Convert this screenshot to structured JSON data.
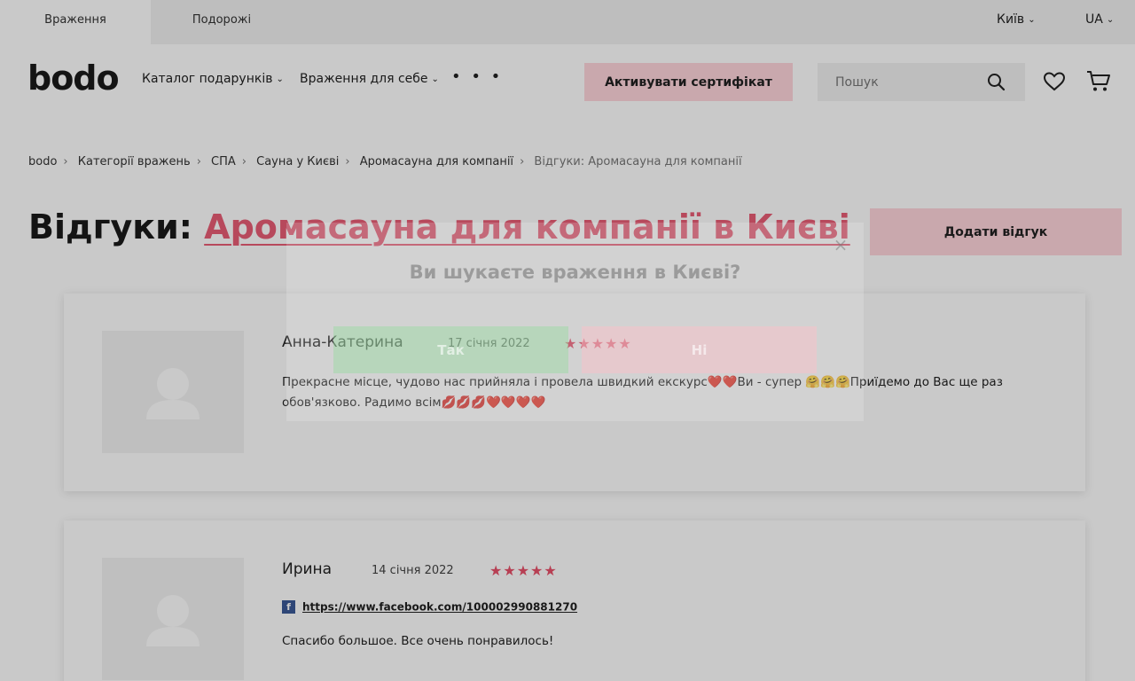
{
  "topbar": {
    "tabs": [
      {
        "label": "Враження"
      },
      {
        "label": "Подорожі"
      }
    ],
    "city": "Київ",
    "lang": "UA"
  },
  "header": {
    "logo": "bodo",
    "nav": {
      "catalog": "Каталог подарунків",
      "self": "Враження для себе",
      "more": "• • •"
    },
    "activate_label": "Активувати сертифікат",
    "search_placeholder": "Пошук"
  },
  "breadcrumb": [
    {
      "label": "bodo"
    },
    {
      "label": "Категорії вражень"
    },
    {
      "label": "СПА"
    },
    {
      "label": "Сауна у Києві"
    },
    {
      "label": "Аромасауна для компанії"
    },
    {
      "label": "Відгуки: Аромасауна для компанії"
    }
  ],
  "page": {
    "title_prefix": "Відгуки: ",
    "title_link": "Аромасауна для компанії в Києві",
    "add_review_label": "Додати відгук"
  },
  "reviews": [
    {
      "name": "Анна-Катерина",
      "date": "17 січня 2022",
      "stars": "★★★★★",
      "rating": 5,
      "text": "Прекрасне місце, чудово нас прийняла і провела швидкий екскурс❤️❤️Ви - супер 🤗🤗🤗Приїдемо до Вас ще раз обов'язково. Радимо всім💋💋💋❤️❤️❤️❤️"
    },
    {
      "name": "Ирина",
      "date": "14 січня 2022",
      "stars": "★★★★★",
      "rating": 5,
      "fb_icon": "f",
      "link": "https://www.facebook.com/100002990881270",
      "text": "Спасибо большое. Все очень понравилось!"
    }
  ],
  "modal": {
    "close": "×",
    "title": "Ви шукаєте враження в Києві?",
    "yes_label": "Так",
    "no_label": "Ні"
  },
  "colors": {
    "accent": "#e85d75",
    "button_pink": "#ffd6dc",
    "stars": "#e8506a",
    "facebook": "#3b5998"
  }
}
